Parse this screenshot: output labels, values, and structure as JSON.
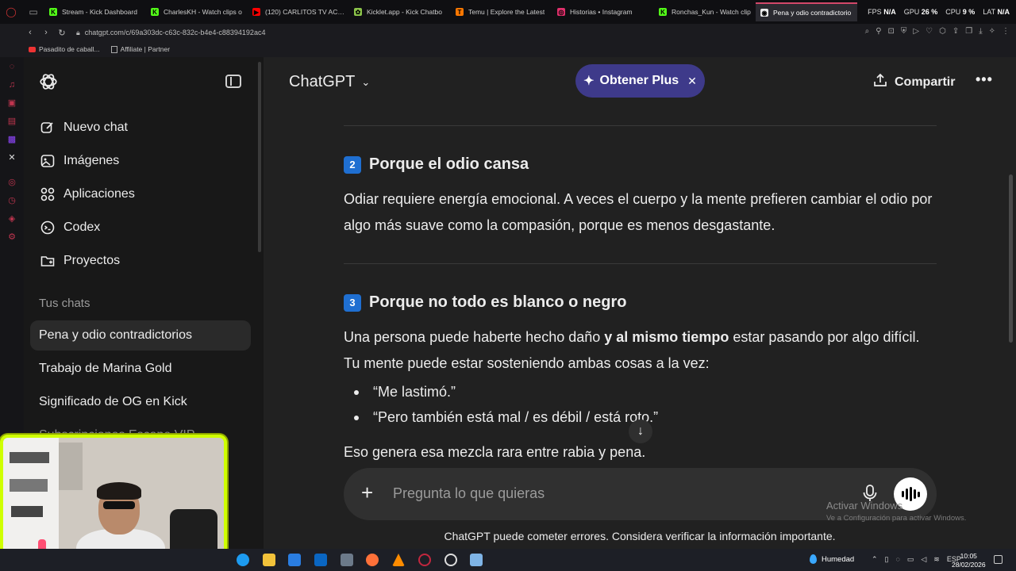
{
  "browser": {
    "tabs": [
      {
        "title": "Stream - Kick Dashboard",
        "fav": "K",
        "color": "#53fc18"
      },
      {
        "title": "CharlesKH - Watch clips o",
        "fav": "K",
        "color": "#53fc18"
      },
      {
        "title": "(120) CARLITOS TV ACLA",
        "fav": "▶",
        "color": "#ff0000"
      },
      {
        "title": "Kicklet.app - Kick Chatbo",
        "fav": "✿",
        "color": "#8bc34a"
      },
      {
        "title": "Temu | Explore the Latest",
        "fav": "T",
        "color": "#fb7701"
      },
      {
        "title": "Historias • Instagram",
        "fav": "◎",
        "color": "#e1306c"
      },
      {
        "title": "Ronchas_Kun - Watch clip",
        "fav": "K",
        "color": "#53fc18"
      },
      {
        "title": "Pena y odio contradictorio",
        "fav": "◉",
        "color": "#ececec",
        "active": true
      }
    ],
    "perf": {
      "fps_label": "FPS",
      "fps": "N/A",
      "gpu_label": "GPU",
      "gpu": "26 %",
      "cpu_label": "CPU",
      "cpu": "9 %",
      "lat_label": "LAT",
      "lat": "N/A"
    },
    "url": "chatgpt.com/c/69a303dc-c63c-832c-b4e4-c88394192ac4",
    "bookmarks": [
      "Pasadito de caball...",
      "Affiliate | Partner"
    ]
  },
  "sidebar": {
    "items": [
      {
        "label": "Nuevo chat",
        "icon": "edit-icon"
      },
      {
        "label": "Imágenes",
        "icon": "image-icon"
      },
      {
        "label": "Aplicaciones",
        "icon": "apps-icon"
      },
      {
        "label": "Codex",
        "icon": "terminal-icon"
      },
      {
        "label": "Proyectos",
        "icon": "folder-icon"
      }
    ],
    "section_title": "Tus chats",
    "chats": [
      {
        "title": "Pena y odio contradictorios",
        "active": true
      },
      {
        "title": "Trabajo de Marina Gold"
      },
      {
        "title": "Significado de OG en Kick"
      },
      {
        "title": "Subscripciones Escape VIP"
      }
    ]
  },
  "header": {
    "model": "ChatGPT",
    "plus_label": "Obtener Plus",
    "share_label": "Compartir"
  },
  "content": {
    "section2": {
      "number": "2",
      "title": "Porque el odio cansa",
      "text": "Odiar requiere energía emocional. A veces el cuerpo y la mente prefieren cambiar el odio por algo más suave como la compasión, porque es menos desgastante."
    },
    "section3": {
      "number": "3",
      "title": "Porque no todo es blanco o negro",
      "text_before": "Una persona puede haberte hecho daño ",
      "text_bold": "y al mismo tiempo",
      "text_after": " estar pasando por algo difícil. Tu mente puede estar sosteniendo ambas cosas a la vez:",
      "bullets": [
        "“Me lastimó.”",
        "“Pero también está mal / es débil / está roto.”"
      ],
      "closing": "Eso genera esa mezcla rara entre rabia y pena."
    }
  },
  "composer": {
    "placeholder": "Pregunta lo que quieras",
    "footnote": "ChatGPT puede cometer errores. Considera verificar la información importante."
  },
  "windows": {
    "activate_title": "Activar Windows",
    "activate_sub": "Ve a Configuración para activar Windows.",
    "weather": "Humedad",
    "lang": "ESP",
    "time": "10:05",
    "date": "28/02/2026"
  }
}
